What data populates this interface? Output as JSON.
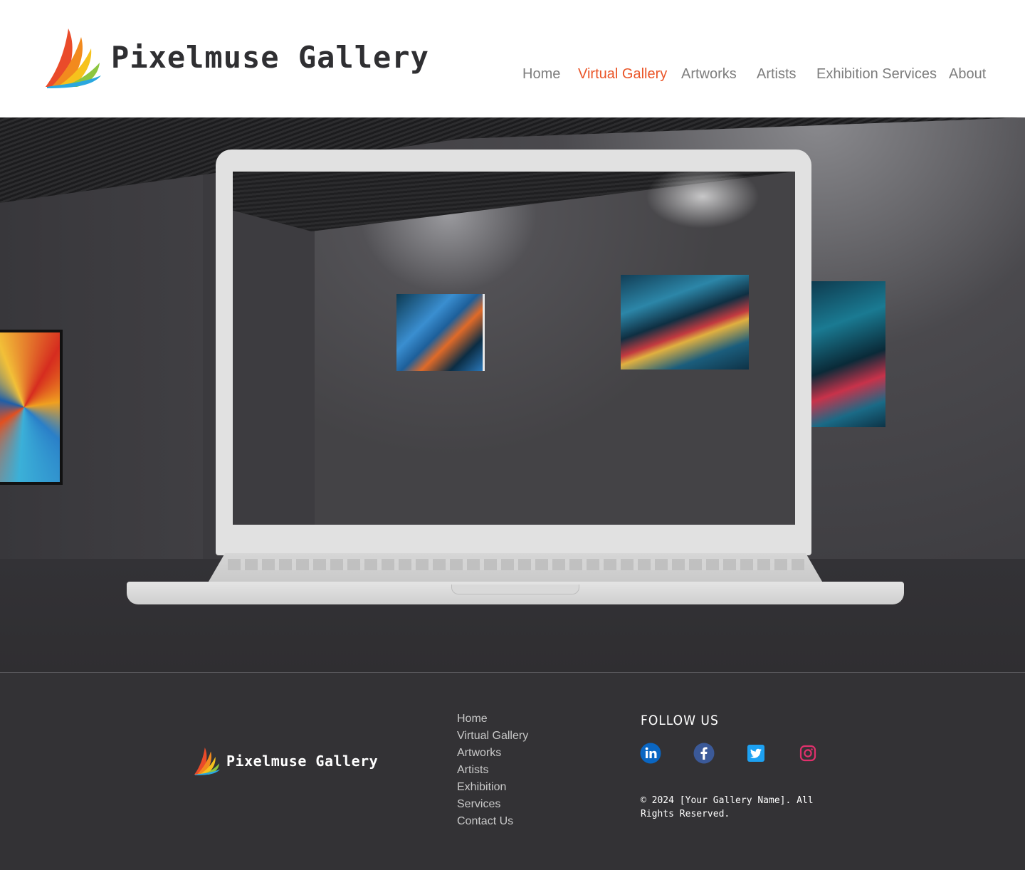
{
  "header": {
    "brand": "Pixelmuse Gallery",
    "nav": [
      {
        "label": "Home",
        "active": false
      },
      {
        "label": "Virtual Gallery",
        "active": true
      },
      {
        "label": "Artworks",
        "active": false
      },
      {
        "label": "Artists",
        "active": false
      },
      {
        "label": "Exhibition Services",
        "active": false
      },
      {
        "label": "About",
        "active": false
      }
    ]
  },
  "colors": {
    "accent": "#ea5528",
    "nav_text": "#7d7d7d",
    "footer_bg": "#333235"
  },
  "hero": {
    "image": "virtual-gallery-laptop-showcase"
  },
  "footer": {
    "brand": "Pixelmuse Gallery",
    "links": [
      "Home",
      "Virtual Gallery",
      "Artworks",
      "Artists",
      "Exhibition",
      "Services",
      "Contact Us"
    ],
    "follow_heading": "FOLLOW US",
    "social": [
      {
        "name": "linkedin-icon",
        "color": "#0a66c2"
      },
      {
        "name": "facebook-icon",
        "color": "#3b5998"
      },
      {
        "name": "twitter-icon",
        "color": "#1da1f2"
      },
      {
        "name": "instagram-icon",
        "color": "#e1306c"
      }
    ],
    "copyright": "© 2024 [Your Gallery Name]. All Rights Reserved."
  }
}
